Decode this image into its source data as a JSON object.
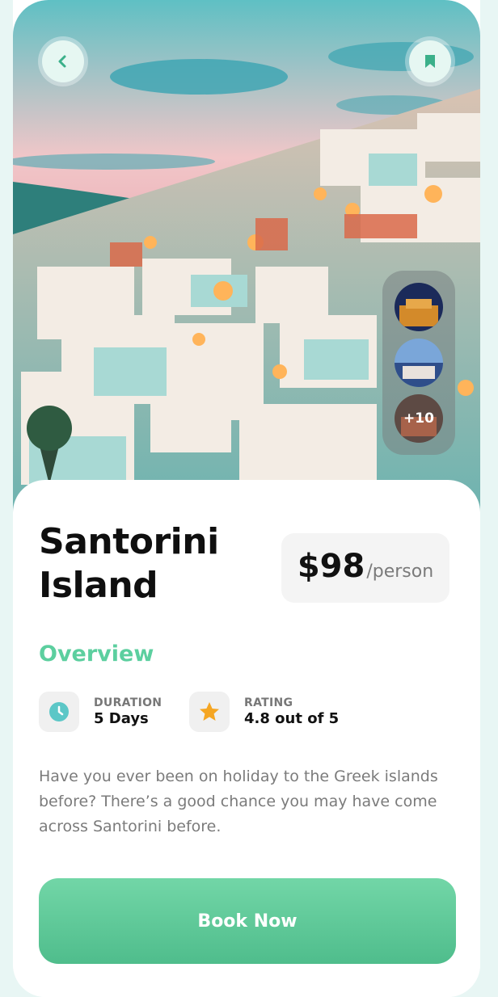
{
  "header": {
    "back_icon": "chevron-left-icon",
    "save_icon": "bookmark-icon"
  },
  "gallery": {
    "more_label": "+10"
  },
  "destination": {
    "title_line1": "Santorini",
    "title_line2": "Island",
    "price": "$98",
    "price_unit": "/person"
  },
  "overview": {
    "heading": "Overview",
    "duration_label": "DURATION",
    "duration_value": "5 Days",
    "rating_label": "RATING",
    "rating_value": "4.8 out of 5",
    "description": "Have you ever been on holiday to the Greek islands before? There’s a good chance you may have come across Santorini before."
  },
  "actions": {
    "book_label": "Book Now"
  },
  "colors": {
    "accent": "#5ccf9f",
    "button": "#5fc798",
    "star": "#f5a623",
    "clock": "#5cc7c7"
  }
}
